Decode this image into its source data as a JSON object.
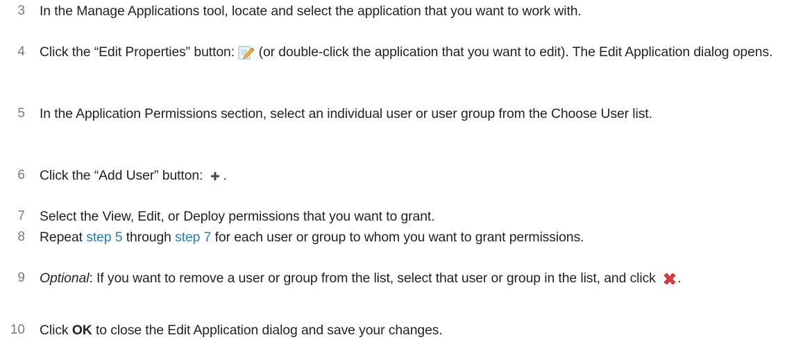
{
  "steps": [
    {
      "num": "3",
      "text": "In the Manage Applications tool, locate and select the application that you want to work with."
    },
    {
      "num": "4",
      "pre": "Click the “Edit Properties” button: ",
      "post": " (or double-click the application that you want to edit). The Edit Application dialog opens."
    },
    {
      "num": "5",
      "text": "In the Application Permissions section, select an individual user or user group from the Choose User list."
    },
    {
      "num": "6",
      "pre": "Click the “Add User” button: ",
      "post": "."
    },
    {
      "num": "7",
      "text": "Select the View, Edit, or Deploy permissions that you want to grant."
    },
    {
      "num": "8",
      "pre": "Repeat ",
      "link1": "step 5",
      "mid": " through ",
      "link2": "step 7",
      "post": " for each user or group to whom you want to grant permissions."
    },
    {
      "num": "9",
      "optional": "Optional",
      "pre": ": If you want to remove a user or group from the list, select that user or group in the list, and click ",
      "post": "."
    },
    {
      "num": "10",
      "pre": "Click ",
      "bold": "OK",
      "post": " to close the Edit Application dialog and save your changes."
    }
  ],
  "icons": {
    "edit_properties": "edit-properties-icon",
    "add_user": "plus-icon",
    "remove": "red-x-icon"
  },
  "colors": {
    "text": "#222222",
    "step_number": "#7a7a7a",
    "link": "#2b7fb8",
    "remove_icon": "#e0393e"
  }
}
